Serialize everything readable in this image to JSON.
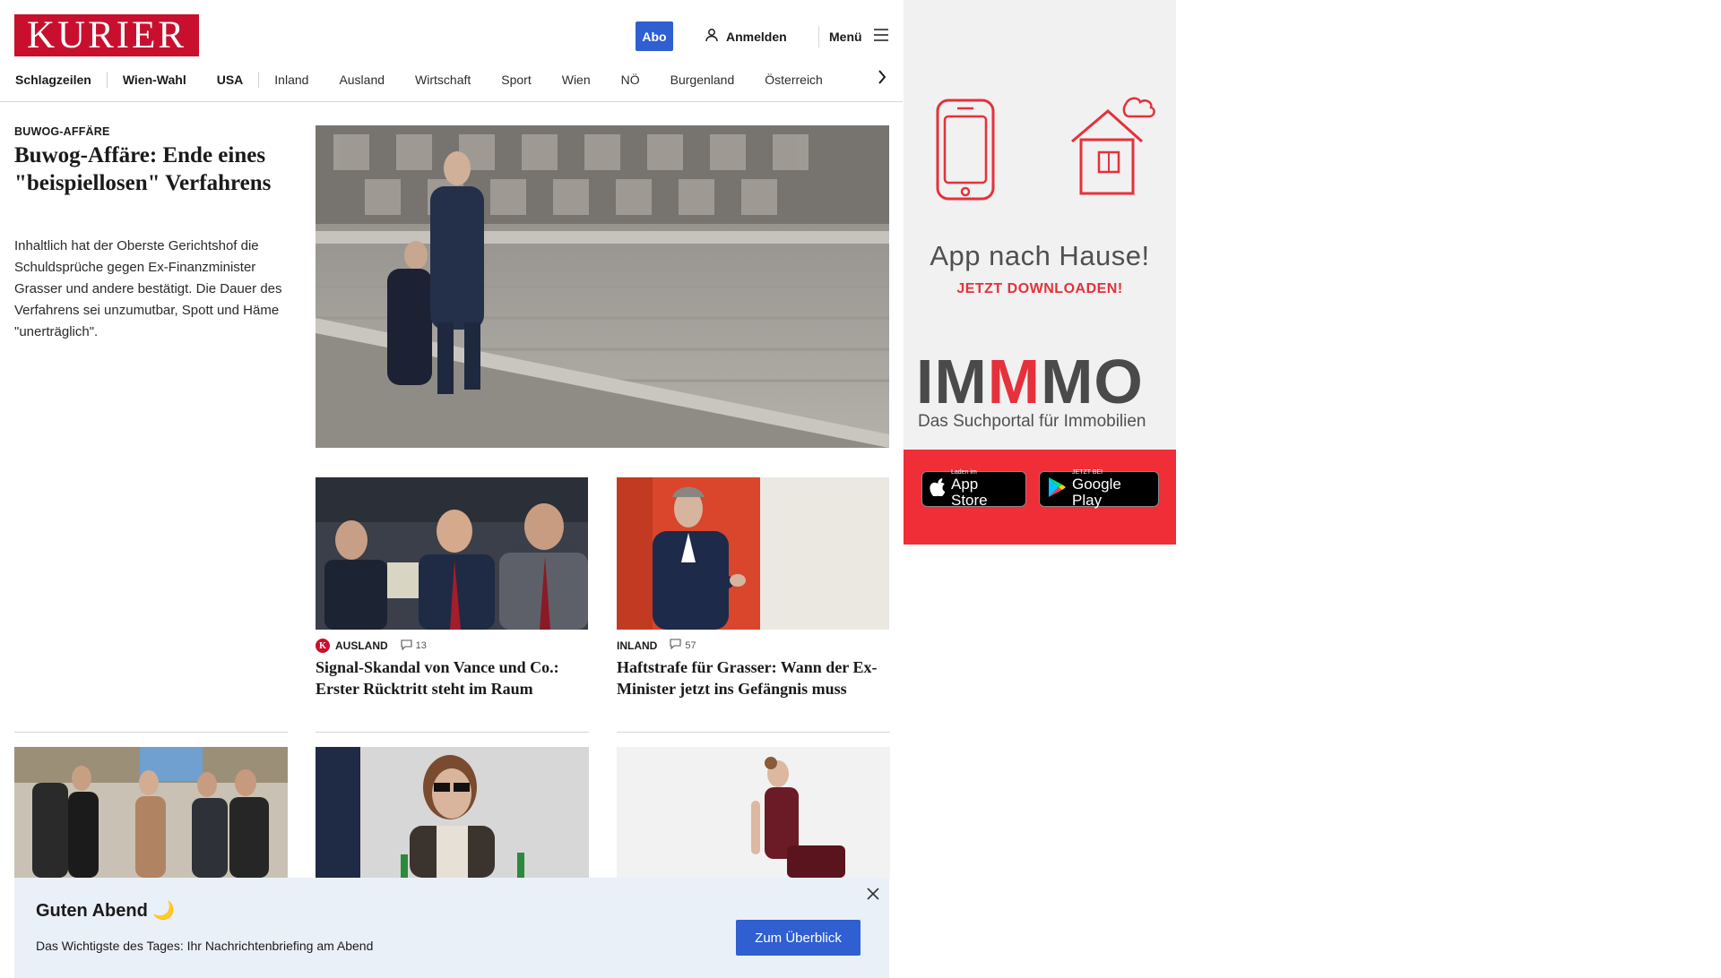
{
  "brand": {
    "logo_text": "KURIER",
    "logo_color": "#c8102e"
  },
  "header": {
    "abo_label": "Abo",
    "login_label": "Anmelden",
    "menu_label": "Menü"
  },
  "nav": {
    "items": [
      "Schlagzeilen",
      "Wien-Wahl",
      "USA",
      "Inland",
      "Ausland",
      "Wirtschaft",
      "Sport",
      "Wien",
      "NÖ",
      "Burgenland",
      "Österreich"
    ]
  },
  "lead": {
    "kicker": "BUWOG-AFFÄRE",
    "title": "Buwog-Affäre: Ende eines \"beispiellosen\" Verfahrens",
    "teaser": "Inhaltlich hat der Oberste Gerichtshof die Schuldsprüche gegen Ex-Finanzminister Grasser und andere bestätigt. Die Dauer des Verfahrens sei unzumutbar, Spott und Häme \"unerträglich\"."
  },
  "cards": [
    {
      "badge": "K",
      "section": "AUSLAND",
      "comments": "13",
      "title": "Signal-Skandal von Vance und Co.: Erster Rücktritt steht im Raum"
    },
    {
      "section": "INLAND",
      "comments": "57",
      "title": "Haftstrafe für Grasser: Wann der Ex-Minister jetzt ins Gefängnis muss"
    }
  ],
  "ad": {
    "headline": "App nach Hause!",
    "subline": "JETZT DOWNLOADEN!",
    "brand_parts": [
      "IM",
      "M",
      "MO"
    ],
    "tagline": "Das Suchportal für Immobilien",
    "appstore_small": "Laden im",
    "appstore_big": "App Store",
    "googleplay_small": "JETZT BEI",
    "googleplay_big": "Google Play",
    "accent_color": "#ef2e38"
  },
  "banner": {
    "title": "Guten Abend 🌙",
    "text": "Das Wichtigste des Tages: Ihr Nachrichtenbriefing am Abend",
    "button": "Zum Überblick"
  },
  "icons": [
    "user-icon",
    "hamburger-icon",
    "chevron-right-icon",
    "comment-icon",
    "apple-icon",
    "play-icon",
    "close-icon"
  ]
}
